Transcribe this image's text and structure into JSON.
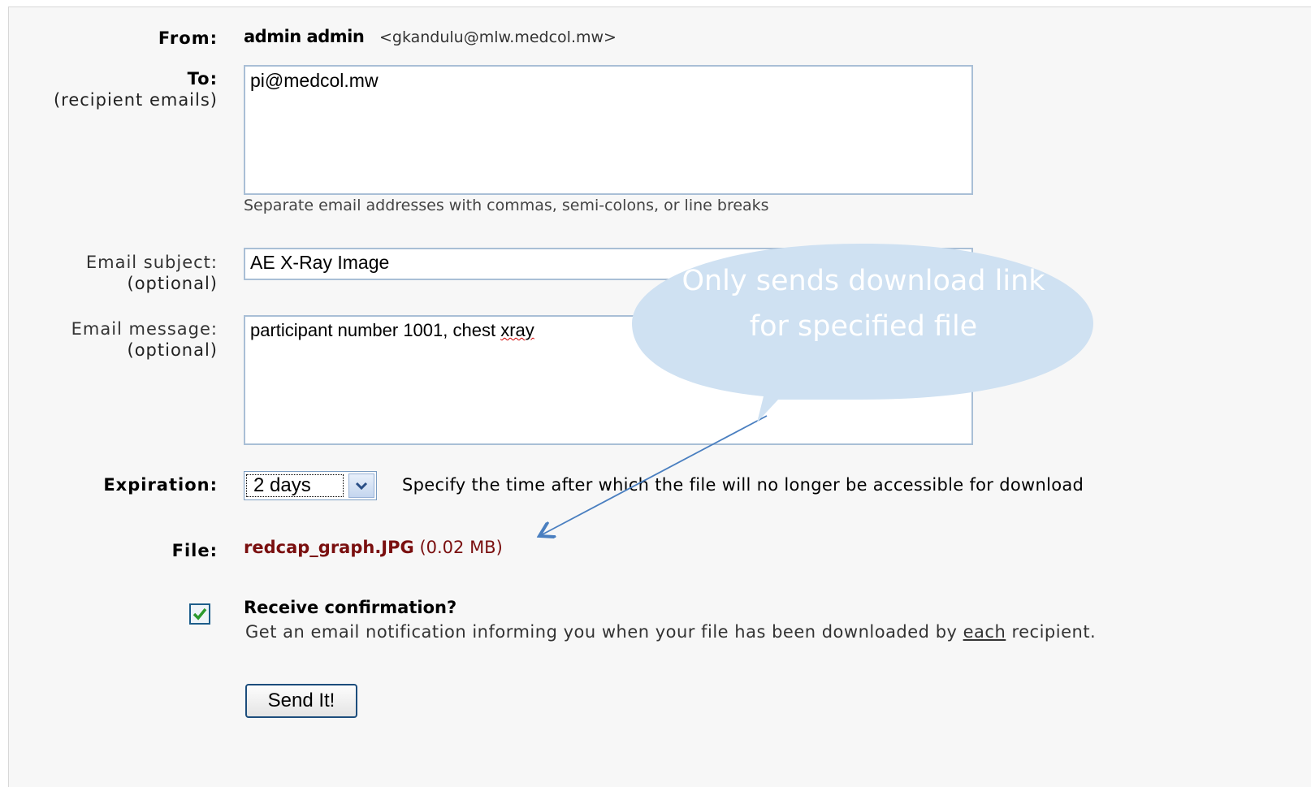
{
  "from": {
    "label": "From:",
    "name": "admin admin",
    "address": "<gkandulu@mlw.medcol.mw>"
  },
  "to": {
    "label": "To:",
    "sublabel": "(recipient emails)",
    "value": "pi@medcol.mw",
    "hint": "Separate email addresses with commas, semi-colons, or line breaks"
  },
  "subject": {
    "label": "Email subject:",
    "sublabel": "(optional)",
    "value": "AE X-Ray Image"
  },
  "message": {
    "label": "Email message:",
    "sublabel": "(optional)",
    "value_main": "participant number 1001, chest ",
    "value_misspelled": "xray"
  },
  "expiration": {
    "label": "Expiration:",
    "selected": "2 days",
    "hint": "Specify the time after which the file will no longer be accessible for download"
  },
  "file": {
    "label": "File:",
    "name": "redcap_graph.JPG",
    "size": "(0.02 MB)"
  },
  "confirmation": {
    "checked": true,
    "title": "Receive confirmation?",
    "desc_before": "Get an email notification informing you when your file has been downloaded by ",
    "desc_emph": "each",
    "desc_after": " recipient."
  },
  "send_button": "Send It!",
  "callout": {
    "text": "Only sends download link for specified file",
    "fill": "#cfe1f2"
  },
  "colors": {
    "file_link": "#7a0f0f",
    "field_border": "#a9bfd6",
    "arrow": "#4a7fc0"
  }
}
